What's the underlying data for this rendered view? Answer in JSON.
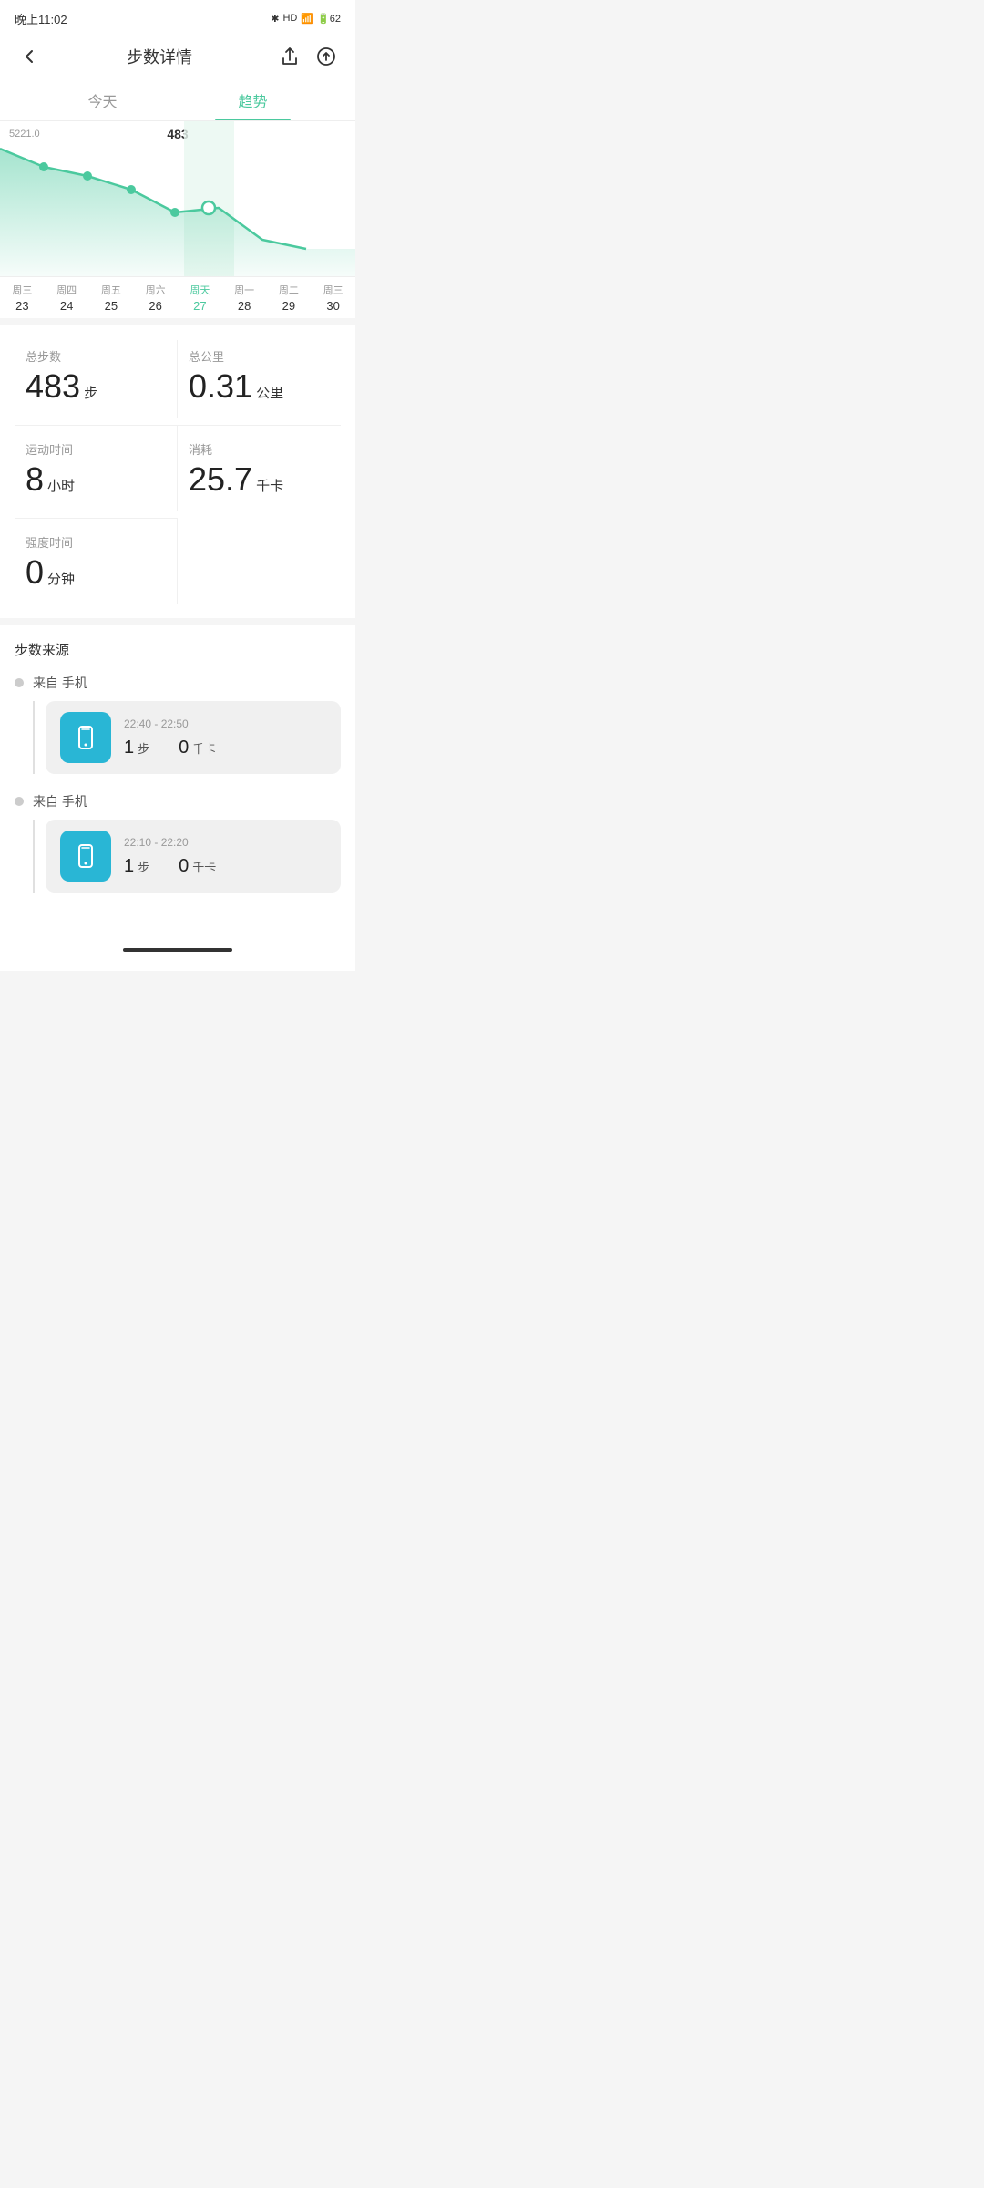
{
  "statusBar": {
    "time": "晚上11:02",
    "icons": "* HD.ill 令 62"
  },
  "header": {
    "title": "步数详情",
    "backLabel": "‹",
    "shareLabel": "⬆",
    "uploadLabel": "⬆"
  },
  "tabs": [
    {
      "id": "today",
      "label": "今天",
      "active": false
    },
    {
      "id": "trend",
      "label": "趋势",
      "active": true
    }
  ],
  "chart": {
    "yLabel": "5221.0",
    "valueLabel": "483",
    "days": [
      {
        "name": "周三",
        "num": "23",
        "active": false
      },
      {
        "name": "周四",
        "num": "24",
        "active": false
      },
      {
        "name": "周五",
        "num": "25",
        "active": false
      },
      {
        "name": "周六",
        "num": "26",
        "active": false
      },
      {
        "name": "周天",
        "num": "27",
        "active": true
      },
      {
        "name": "周一",
        "num": "28",
        "active": false
      },
      {
        "name": "周二",
        "num": "29",
        "active": false
      },
      {
        "name": "周三",
        "num": "30",
        "active": false
      }
    ]
  },
  "stats": [
    {
      "label": "总步数",
      "value": "483",
      "unit": "步"
    },
    {
      "label": "总公里",
      "value": "0.31",
      "unit": "公里"
    },
    {
      "label": "运动时间",
      "value": "8",
      "unit": "小时"
    },
    {
      "label": "消耗",
      "value": "25.7",
      "unit": "千卡"
    },
    {
      "label": "强度时间",
      "value": "0",
      "unit": "分钟"
    }
  ],
  "sourceSection": {
    "title": "步数来源",
    "groups": [
      {
        "name": "来自 手机",
        "time": "22:40 - 22:50",
        "steps": "1",
        "stepsUnit": "步",
        "calories": "0",
        "caloriesUnit": "千卡"
      },
      {
        "name": "来自 手机",
        "time": "22:10 - 22:20",
        "steps": "1",
        "stepsUnit": "步",
        "calories": "0",
        "caloriesUnit": "千卡"
      }
    ]
  }
}
